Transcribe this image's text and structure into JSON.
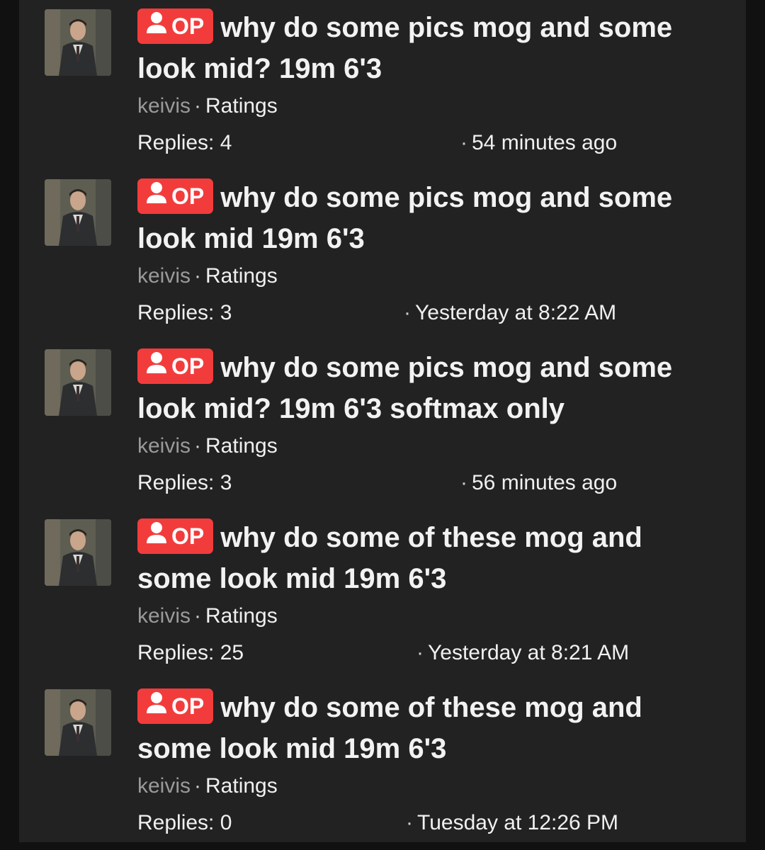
{
  "colors": {
    "op_badge": "#f23c3c",
    "background": "#222222",
    "title_text": "#f2f2f2",
    "author_text": "#9a9a9a"
  },
  "threads": [
    {
      "badge": "OP",
      "badge_icon": "person-icon",
      "title": "why do some pics mog and some look mid? 19m 6'3",
      "author": "keivis",
      "separator": "·",
      "forum": "Ratings",
      "replies": "Replies: 4",
      "time_dot": "·",
      "time": "54 minutes ago"
    },
    {
      "badge": "OP",
      "badge_icon": "person-icon",
      "title": "why do some pics mog and some look mid 19m 6'3",
      "author": "keivis",
      "separator": "·",
      "forum": "Ratings",
      "replies": "Replies: 3",
      "time_dot": "·",
      "time": "Yesterday at 8:22 AM"
    },
    {
      "badge": "OP",
      "badge_icon": "person-icon",
      "title": "why do some pics mog and some look mid? 19m 6'3 softmax only",
      "author": "keivis",
      "separator": "·",
      "forum": "Ratings",
      "replies": "Replies: 3",
      "time_dot": "·",
      "time": "56 minutes ago"
    },
    {
      "badge": "OP",
      "badge_icon": "person-icon",
      "title": "why do some of these mog and some look mid 19m 6'3",
      "author": "keivis",
      "separator": "·",
      "forum": "Ratings",
      "replies": "Replies: 25",
      "time_dot": "·",
      "time": "Yesterday at 8:21 AM"
    },
    {
      "badge": "OP",
      "badge_icon": "person-icon",
      "title": "why do some of these mog and some look mid 19m 6'3",
      "author": "keivis",
      "separator": "·",
      "forum": "Ratings",
      "replies": "Replies: 0",
      "time_dot": "·",
      "time": "Tuesday at 12:26 PM"
    }
  ]
}
